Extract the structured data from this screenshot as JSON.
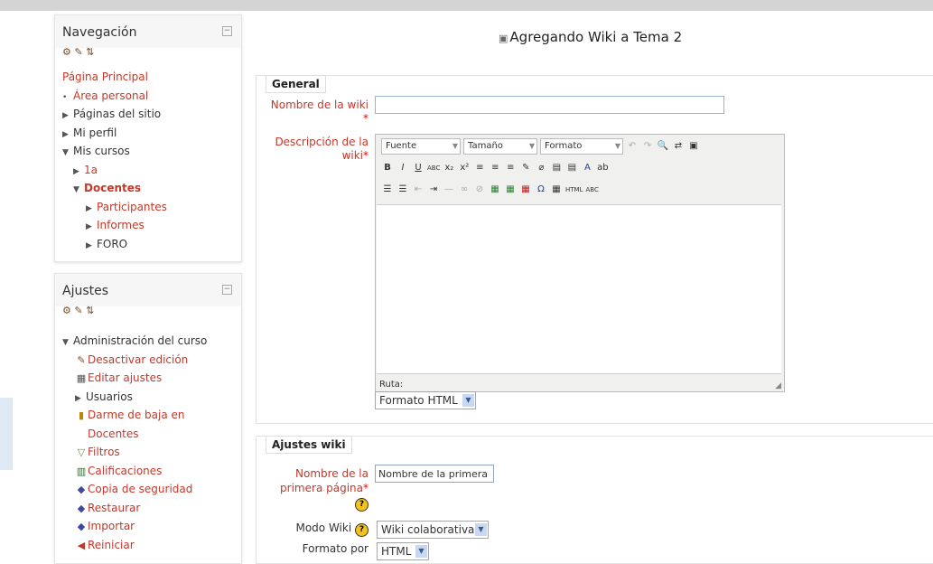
{
  "nav_block": {
    "title": "Navegación",
    "collapse": "−",
    "tools": "⚙ ✎ ⇅",
    "items": [
      {
        "label": "Página Principal",
        "caret": ""
      },
      {
        "label": "Área personal",
        "caret": "•"
      },
      {
        "label": "Páginas del sitio",
        "caret": "▶"
      },
      {
        "label": "Mi perfil",
        "caret": "▶"
      },
      {
        "label": "Mis cursos",
        "caret": "▼"
      },
      {
        "label": "1a",
        "caret": "▶"
      },
      {
        "label": "Docentes",
        "caret": "▼"
      },
      {
        "label": "Participantes",
        "caret": "▶"
      },
      {
        "label": "Informes",
        "caret": "▶"
      },
      {
        "label": "FORO",
        "caret": "▶"
      }
    ]
  },
  "settings_block": {
    "title": "Ajustes",
    "collapse": "−",
    "tools": "⚙ ✎ ⇅",
    "admin": {
      "label": "Administración del curso",
      "caret": "▼"
    },
    "items": [
      {
        "label": "Desactivar edición",
        "icon": "✎"
      },
      {
        "label": "Editar ajustes",
        "icon": "▦"
      },
      {
        "label": "Usuarios",
        "icon": "▶"
      },
      {
        "label": "Darme de baja en",
        "icon": "▮"
      },
      {
        "label": "Docentes",
        "icon": ""
      },
      {
        "label": "Filtros",
        "icon": "▽"
      },
      {
        "label": "Calificaciones",
        "icon": "▥"
      },
      {
        "label": "Copia de seguridad",
        "icon": "◆"
      },
      {
        "label": "Restaurar",
        "icon": "◆"
      },
      {
        "label": "Importar",
        "icon": "◆"
      },
      {
        "label": "Reiniciar",
        "icon": "◀"
      }
    ]
  },
  "page": {
    "title": "Agregando Wiki a Tema 2",
    "title_icon": "▣"
  },
  "general": {
    "legend": "General",
    "name_label_1": "Nombre de la wiki",
    "name_label_2": "*",
    "name_value": "",
    "desc_label_1": "Descripción de la",
    "desc_label_2": "wiki",
    "req": "*",
    "editor": {
      "font": "Fuente",
      "size": "Tamaño",
      "format": "Formato",
      "ruta": "Ruta:",
      "grip": "◢",
      "row1_icons": [
        "↶",
        "↷",
        "🔍",
        "⇄",
        "▣"
      ],
      "row2_icons": [
        "B",
        "I",
        "U",
        "ABC",
        "x₂",
        "x²",
        "≡",
        "≡",
        "≡",
        "✎",
        "⌀",
        "▤",
        "▤",
        "A",
        "ab"
      ],
      "row3_icons": [
        "☰",
        "☰",
        "⇤",
        "⇥",
        "—",
        "∞",
        "⊘",
        "▦",
        "▦",
        "▦",
        "Ω",
        "▦",
        "HTML",
        "ABC"
      ]
    },
    "format_select": "Formato HTML"
  },
  "wiki": {
    "legend": "Ajustes wiki",
    "first_page_label_1": "Nombre de la",
    "first_page_label_2": "primera página",
    "first_page_value": "Nombre de la primera",
    "help": "?",
    "mode_label": "Modo Wiki",
    "mode_value": "Wiki colaborativa",
    "format_label": "Formato por",
    "format_value": "HTML"
  }
}
